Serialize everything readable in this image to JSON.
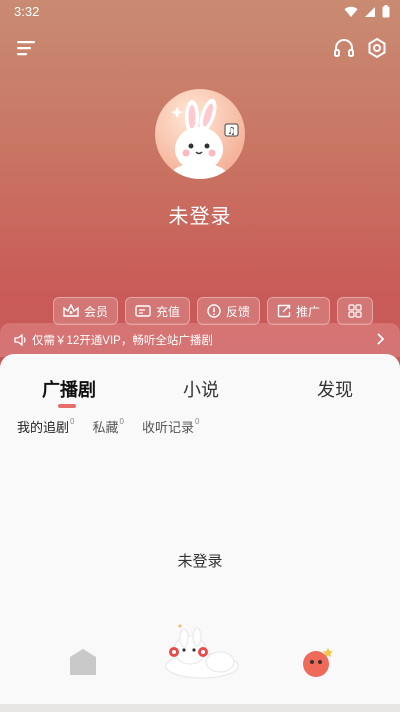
{
  "status_bar": {
    "time": "3:32"
  },
  "profile": {
    "name": "未登录"
  },
  "quick_actions": [
    {
      "label": "会员",
      "icon": "crown-icon"
    },
    {
      "label": "充值",
      "icon": "ticket-icon"
    },
    {
      "label": "反馈",
      "icon": "alert-icon"
    },
    {
      "label": "推广",
      "icon": "share-icon"
    },
    {
      "label": "",
      "icon": "grid-icon"
    }
  ],
  "vip_banner": {
    "text": "仅需￥12开通VIP，畅听全站广播剧"
  },
  "tabs": [
    {
      "label": "广播剧",
      "active": true
    },
    {
      "label": "小说",
      "active": false
    },
    {
      "label": "发现",
      "active": false
    }
  ],
  "subtabs": [
    {
      "label": "我的追剧",
      "count": "0"
    },
    {
      "label": "私藏",
      "count": "0"
    },
    {
      "label": "收听记录",
      "count": "0"
    }
  ],
  "empty_state": {
    "text": "未登录"
  },
  "bottom_nav": [
    {
      "icon": "home-icon"
    },
    {
      "icon": "bunny-mascot-icon"
    },
    {
      "icon": "red-bean-icon"
    }
  ],
  "colors": {
    "accent": "#e86e6e",
    "hero_top": "#c98b72",
    "hero_bottom": "#c45a5a"
  }
}
